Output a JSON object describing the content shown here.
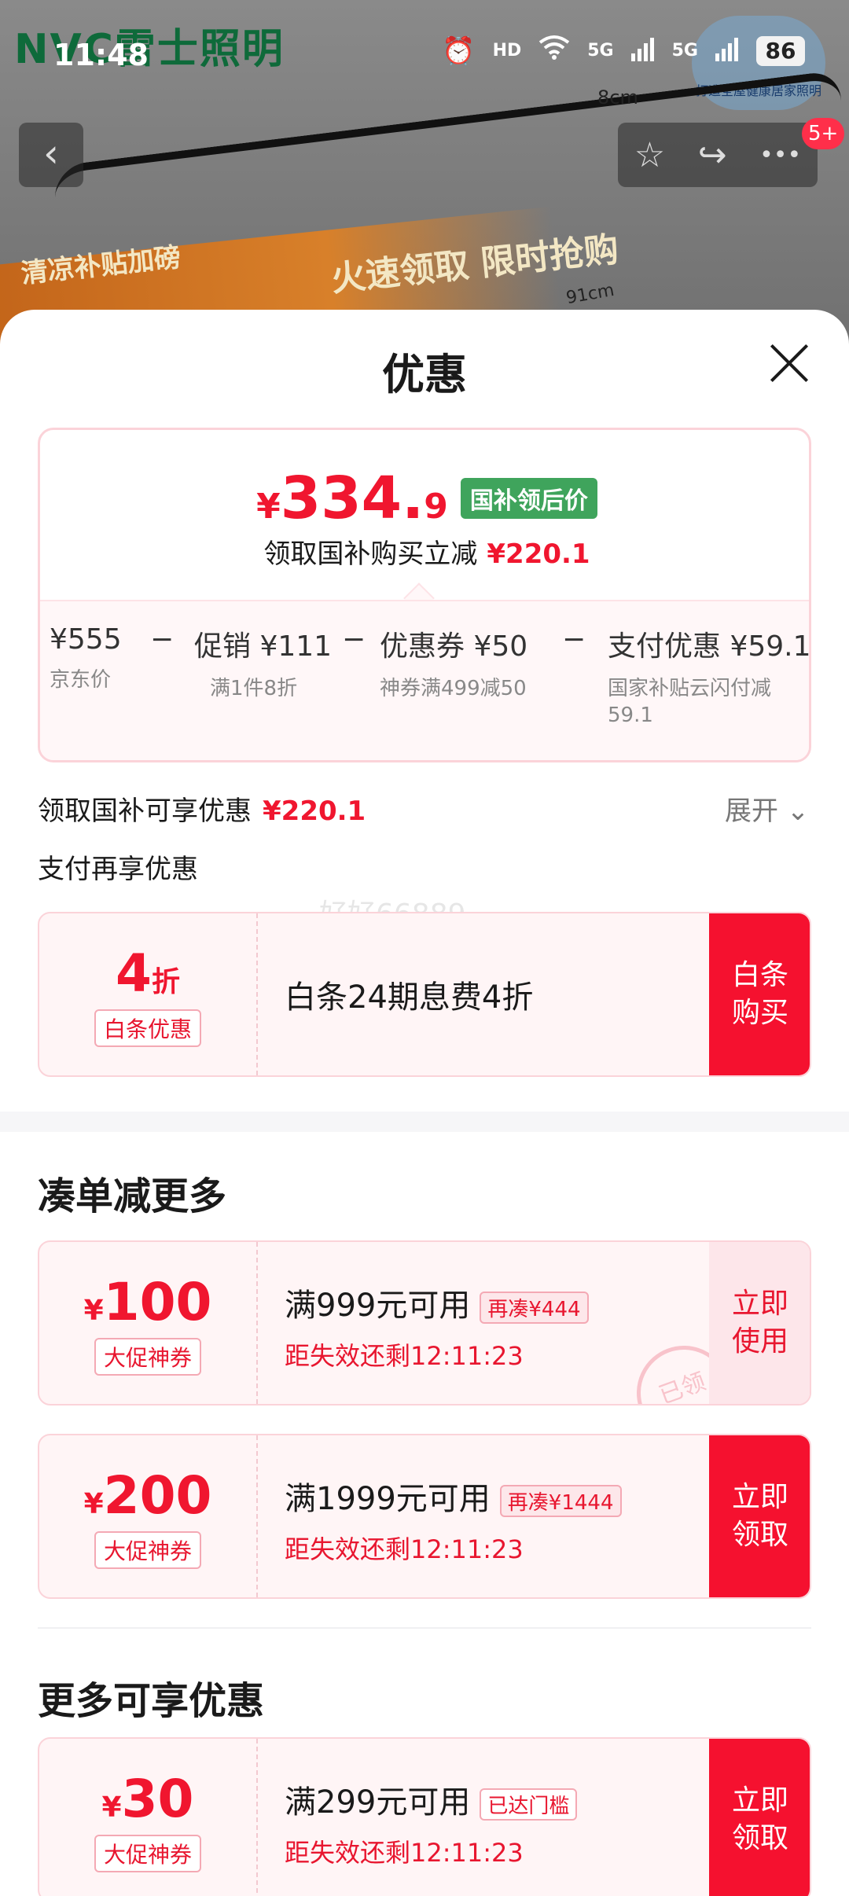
{
  "status_bar": {
    "time": "11:48",
    "net1": "5G",
    "net2": "5G",
    "hd": "HD",
    "battery": "86"
  },
  "background": {
    "brand": "NVC雷士照明",
    "badge_text": "打造全屋健康居家照明",
    "dim_height": "8cm",
    "dim_width": "91cm",
    "banner_left": "清凉补贴加磅",
    "banner_right": "火速领取 限时抢购"
  },
  "nav": {
    "back_icon": "‹",
    "fav_icon": "☆",
    "share_icon": "↪",
    "more_icon": "•••",
    "msg_count": "5+"
  },
  "sheet": {
    "title": "优惠",
    "price": {
      "symbol": "¥",
      "integer": "334.",
      "decimal": "9",
      "tag": "国补领后价"
    },
    "price_sub": {
      "text": "领取国补购买立减",
      "amount": "¥220.1"
    },
    "breakdown": [
      {
        "main": "¥555",
        "sub": "京东价"
      },
      {
        "main": "促销 ¥111",
        "sub": "满1件8折"
      },
      {
        "main": "优惠券 ¥50",
        "sub": "神券满499减50"
      },
      {
        "main": "支付优惠 ¥59.1",
        "sub": "国家补贴云闪付减59.1"
      }
    ],
    "minus": "−",
    "subsidy_row": {
      "text": "领取国补可享优惠",
      "amount": "¥220.1"
    },
    "expand_label": "展开 ⌄",
    "pay_row": "支付再享优惠",
    "watermark": "好好66889",
    "baitiao": {
      "num": "4",
      "unit": "折",
      "label": "白条优惠",
      "title": "白条24期息费4折",
      "button": "白条购买"
    },
    "section1_title": "凑单减更多",
    "coupons1": [
      {
        "symbol": "¥",
        "amount": "100",
        "label": "大促神券",
        "title": "满999元可用",
        "chip": "再凑¥444",
        "expire": "距失效还剩12:11:23",
        "button": "立即使用",
        "stamp": "已领"
      },
      {
        "symbol": "¥",
        "amount": "200",
        "label": "大促神券",
        "title": "满1999元可用",
        "chip": "再凑¥1444",
        "expire": "距失效还剩12:11:23",
        "button": "立即领取"
      }
    ],
    "section2_title": "更多可享优惠",
    "coupons2": [
      {
        "symbol": "¥",
        "amount": "30",
        "label": "大促神券",
        "title": "满299元可用",
        "chip": "已达门槛",
        "expire": "距失效还剩12:11:23",
        "button": "立即领取"
      }
    ]
  },
  "colors": {
    "accent_red": "#f0162f",
    "tag_green": "#3fa45c"
  }
}
